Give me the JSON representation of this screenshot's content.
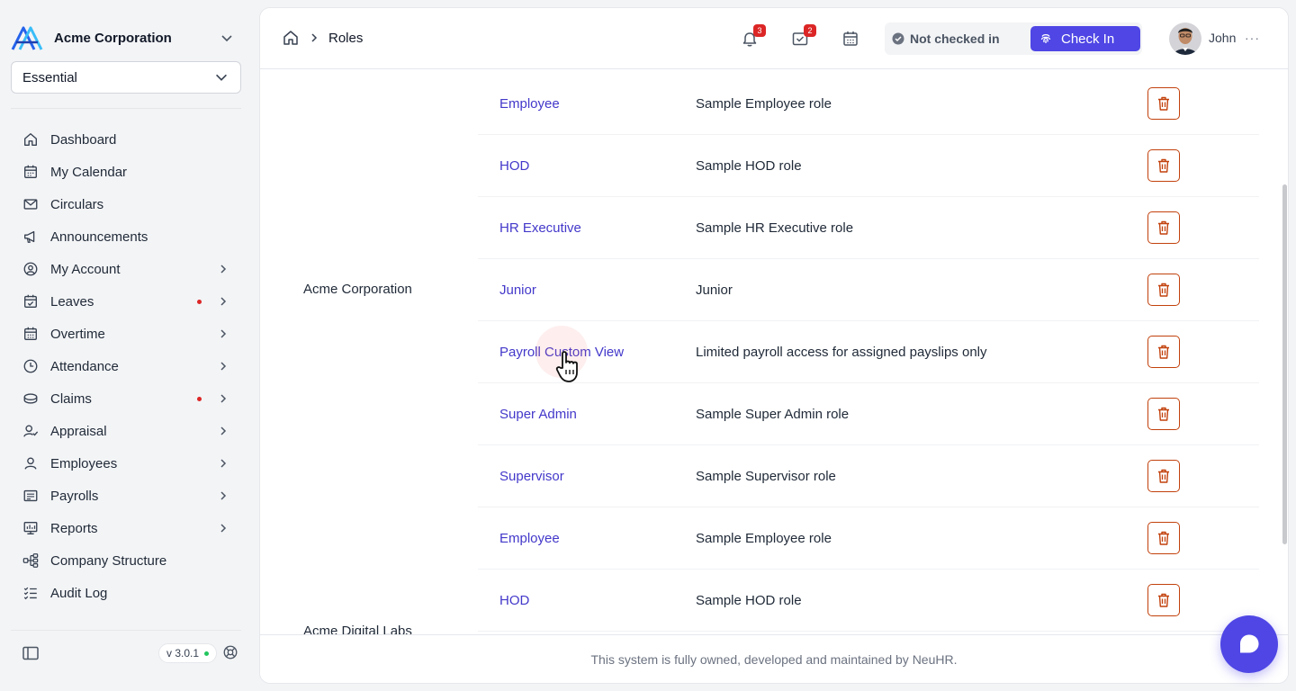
{
  "colors": {
    "accent": "#4f46e5",
    "link": "#4338ca",
    "danger": "#c2410c",
    "badge": "#dc2626",
    "online": "#22c55e"
  },
  "sidebar": {
    "company": "Acme Corporation",
    "plan": "Essential",
    "items": [
      {
        "label": "Dashboard",
        "icon": "home-icon"
      },
      {
        "label": "My Calendar",
        "icon": "calendar-icon"
      },
      {
        "label": "Circulars",
        "icon": "mail-icon"
      },
      {
        "label": "Announcements",
        "icon": "megaphone-icon"
      },
      {
        "label": "My Account",
        "icon": "user-circle-icon"
      },
      {
        "label": "Leaves",
        "icon": "calendar-check-icon"
      },
      {
        "label": "Overtime",
        "icon": "calendar-grid-icon"
      },
      {
        "label": "Attendance",
        "icon": "clock-icon"
      },
      {
        "label": "Claims",
        "icon": "coins-icon"
      },
      {
        "label": "Appraisal",
        "icon": "user-check-icon"
      },
      {
        "label": "Employees",
        "icon": "user-icon"
      },
      {
        "label": "Payrolls",
        "icon": "receipt-icon"
      },
      {
        "label": "Reports",
        "icon": "chart-icon"
      },
      {
        "label": "Company Structure",
        "icon": "hierarchy-icon"
      },
      {
        "label": "Audit Log",
        "icon": "list-check-icon"
      }
    ],
    "version": "v 3.0.1"
  },
  "header": {
    "breadcrumb": "Roles",
    "notifications_count": "3",
    "tasks_count": "2",
    "checkin_status": "Not checked in",
    "checkin_button": "Check In",
    "user_name": "John",
    "more": "···"
  },
  "table": {
    "groups": [
      {
        "org": "Acme Corporation"
      },
      {
        "org": "Acme Digital Labs"
      }
    ],
    "rows": [
      {
        "role": "Employee",
        "description": "Sample Employee role"
      },
      {
        "role": "HOD",
        "description": "Sample HOD role"
      },
      {
        "role": "HR Executive",
        "description": "Sample HR Executive role"
      },
      {
        "role": "Junior",
        "description": "Junior"
      },
      {
        "role": "Payroll Custom View",
        "description": "Limited payroll access for assigned payslips only"
      },
      {
        "role": "Super Admin",
        "description": "Sample Super Admin role"
      },
      {
        "role": "Supervisor",
        "description": "Sample Supervisor role"
      },
      {
        "role": "Employee",
        "description": "Sample Employee role"
      },
      {
        "role": "HOD",
        "description": "Sample HOD role"
      }
    ]
  },
  "footer": {
    "text": "This system is fully owned, developed and maintained by NeuHR."
  }
}
